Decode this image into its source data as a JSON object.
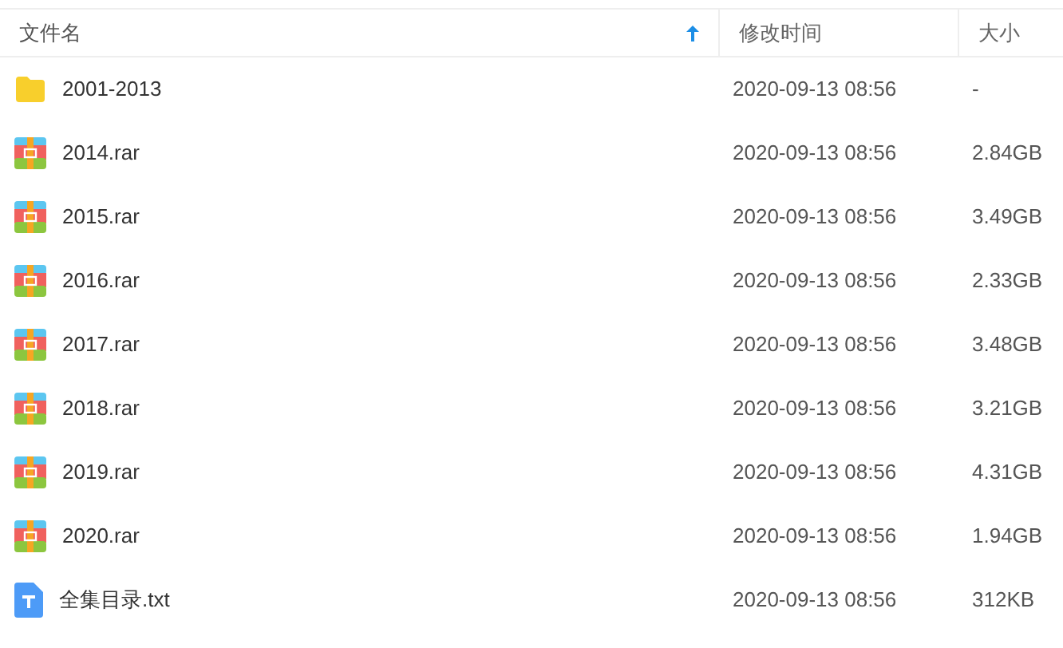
{
  "table": {
    "columns": [
      {
        "label": "文件名",
        "sorted": true
      },
      {
        "label": "修改时间",
        "sorted": false
      },
      {
        "label": "大小",
        "sorted": false
      }
    ],
    "rows": [
      {
        "kind": "folder",
        "name": "2001-2013",
        "modified": "2020-09-13 08:56",
        "size": "-"
      },
      {
        "kind": "archive",
        "name": "2014.rar",
        "modified": "2020-09-13 08:56",
        "size": "2.84GB"
      },
      {
        "kind": "archive",
        "name": "2015.rar",
        "modified": "2020-09-13 08:56",
        "size": "3.49GB"
      },
      {
        "kind": "archive",
        "name": "2016.rar",
        "modified": "2020-09-13 08:56",
        "size": "2.33GB"
      },
      {
        "kind": "archive",
        "name": "2017.rar",
        "modified": "2020-09-13 08:56",
        "size": "3.48GB"
      },
      {
        "kind": "archive",
        "name": "2018.rar",
        "modified": "2020-09-13 08:56",
        "size": "3.21GB"
      },
      {
        "kind": "archive",
        "name": "2019.rar",
        "modified": "2020-09-13 08:56",
        "size": "4.31GB"
      },
      {
        "kind": "archive",
        "name": "2020.rar",
        "modified": "2020-09-13 08:56",
        "size": "1.94GB"
      },
      {
        "kind": "text",
        "name": "全集目录.txt",
        "modified": "2020-09-13 08:56",
        "size": "312KB"
      }
    ]
  }
}
